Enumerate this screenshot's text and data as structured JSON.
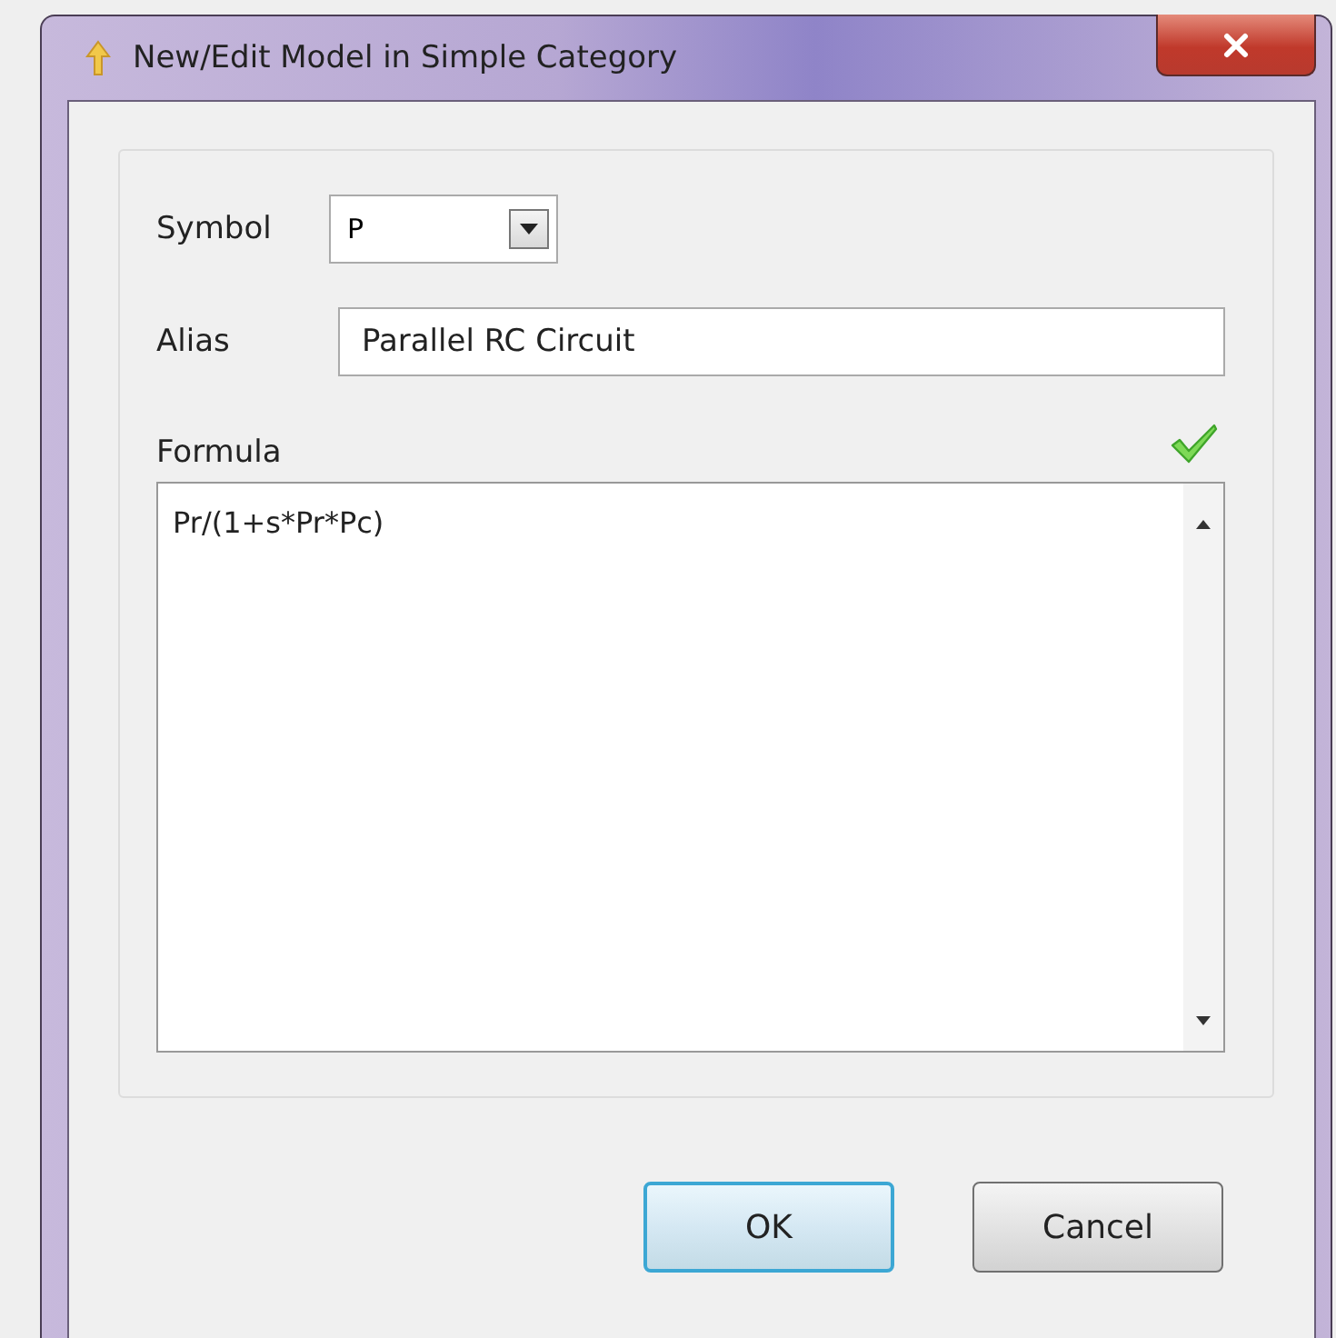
{
  "window": {
    "title": "New/Edit Model in Simple Category"
  },
  "symbol": {
    "label": "Symbol",
    "value": "P"
  },
  "alias": {
    "label": "Alias",
    "value": "Parallel RC Circuit"
  },
  "formula": {
    "label": "Formula",
    "valid": true,
    "value": "Pr/(1+s*Pr*Pc)"
  },
  "buttons": [
    {
      "label": "OK",
      "default": true
    },
    {
      "label": "Cancel",
      "default": false
    }
  ]
}
